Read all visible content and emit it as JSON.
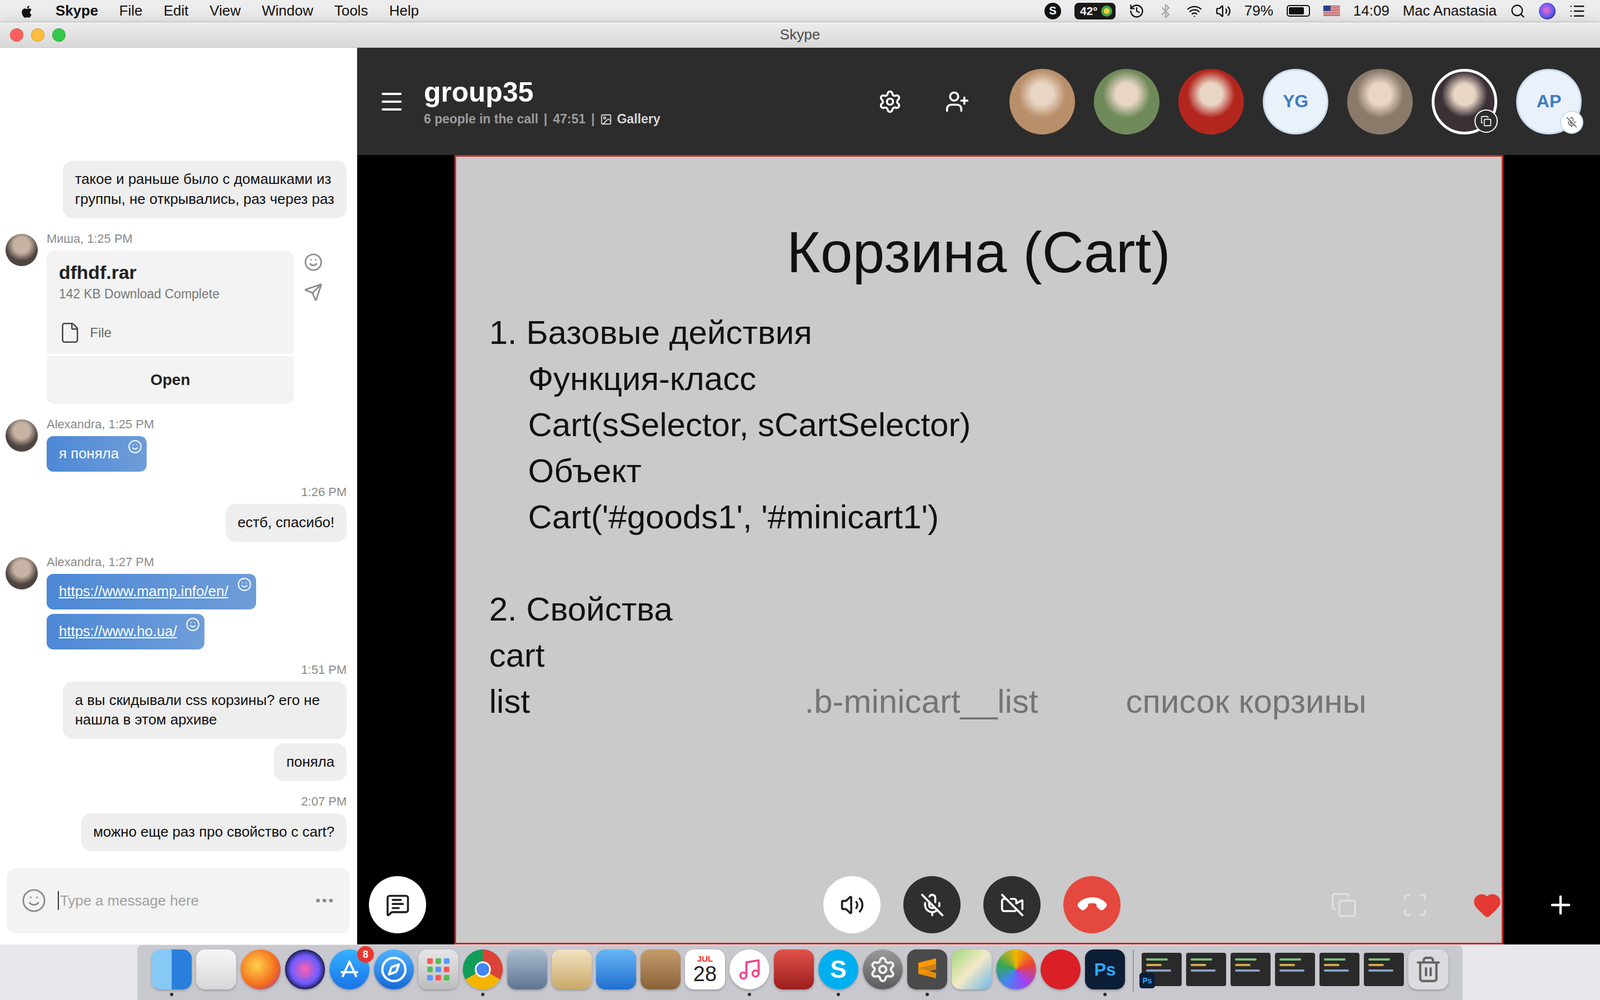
{
  "menubar": {
    "app": "Skype",
    "menus": [
      "File",
      "Edit",
      "View",
      "Window",
      "Tools",
      "Help"
    ],
    "skype_logo": "S",
    "temperature": "42°",
    "battery": "79%",
    "battery_level": 0.79,
    "time": "14:09",
    "user": "Mac Anastasia"
  },
  "window": {
    "title": "Skype"
  },
  "chat": {
    "messages": [
      {
        "kind": "own",
        "time": "",
        "texts": [
          "такое и раньше было с домашками из группы, не открывались, раз через раз"
        ]
      },
      {
        "kind": "file",
        "header": "Миша, 1:25 PM",
        "file": {
          "name": "dfhdf.rar",
          "status": "142 KB Download Complete",
          "type": "File",
          "action": "Open"
        }
      },
      {
        "kind": "incoming",
        "header": "Alexandra, 1:25 PM",
        "texts": [
          "я поняла"
        ],
        "links": false
      },
      {
        "kind": "own",
        "time": "1:26 PM",
        "texts": [
          "естб, спасибо!"
        ]
      },
      {
        "kind": "incoming",
        "header": "Alexandra, 1:27 PM",
        "texts": [
          "https://www.mamp.info/en/",
          "https://www.ho.ua/"
        ],
        "links": true
      },
      {
        "kind": "own",
        "time": "1:51 PM",
        "texts": [
          "а вы скидывали css корзины? его не нашла в этом архиве",
          "поняла"
        ]
      },
      {
        "kind": "own",
        "time": "2:07 PM",
        "texts": [
          "можно еще раз про свойство с cart?"
        ]
      }
    ],
    "input": {
      "placeholder": "Type a message here"
    }
  },
  "call": {
    "name": "group35",
    "people": "6 people in the call",
    "separator": "|",
    "duration": "47:51",
    "view": "Gallery",
    "participants": [
      {
        "kind": "photo",
        "initials": "",
        "color": "#b98e6a",
        "selected": false,
        "muted": false,
        "pinned": false
      },
      {
        "kind": "photo",
        "initials": "",
        "color": "#6f8a5a",
        "selected": false,
        "muted": false,
        "pinned": false
      },
      {
        "kind": "photo",
        "initials": "",
        "color": "#b3261e",
        "selected": false,
        "muted": false,
        "pinned": false
      },
      {
        "kind": "initials",
        "initials": "YG",
        "color": "#eaf1fb",
        "selected": false,
        "muted": false,
        "pinned": false
      },
      {
        "kind": "photo",
        "initials": "",
        "color": "#8a7a6a",
        "selected": false,
        "muted": false,
        "pinned": false
      },
      {
        "kind": "photo",
        "initials": "",
        "color": "#3a3036",
        "selected": true,
        "muted": false,
        "pinned": true
      },
      {
        "kind": "initials",
        "initials": "AP",
        "color": "#eaf1fb",
        "selected": false,
        "muted": true,
        "pinned": false
      }
    ],
    "controls": [
      {
        "kind": "speaker",
        "off": false
      },
      {
        "kind": "mic",
        "off": true
      },
      {
        "kind": "camera",
        "off": true
      },
      {
        "kind": "hangup",
        "off": false
      }
    ]
  },
  "slide": {
    "title": "Корзина (Cart)",
    "sections": [
      {
        "heading": "1. Базовые действия",
        "lines": [
          "Функция-класс",
          "Cart(sSelector, sCartSelector)",
          "Объект",
          "Cart('#goods1', '#minicart1')"
        ],
        "properties": []
      },
      {
        "heading": "2. Свойства",
        "lines": [],
        "properties": [
          {
            "name": "cart",
            "selector": "",
            "description": ""
          },
          {
            "name": "list",
            "selector": ".b-minicart__list",
            "description": "список корзины"
          }
        ]
      }
    ]
  },
  "dock": {
    "apps": [
      {
        "running": true
      },
      {
        "running": false
      },
      {
        "running": false
      },
      {
        "running": false
      },
      {
        "running": false
      },
      {
        "running": false
      },
      {
        "running": false
      },
      {
        "running": true
      },
      {
        "running": false
      },
      {
        "running": false
      },
      {
        "running": false
      },
      {
        "running": false
      },
      {
        "running": false
      },
      {
        "running": true
      },
      {
        "running": false
      },
      {
        "running": true
      },
      {
        "running": false
      },
      {
        "running": true
      },
      {
        "running": false
      },
      {
        "running": false
      },
      {
        "running": false
      },
      {
        "running": true
      }
    ],
    "calendar_month": "JUL",
    "calendar_day": "28",
    "app_store_badge": "8",
    "photoshop_label": "Ps"
  }
}
